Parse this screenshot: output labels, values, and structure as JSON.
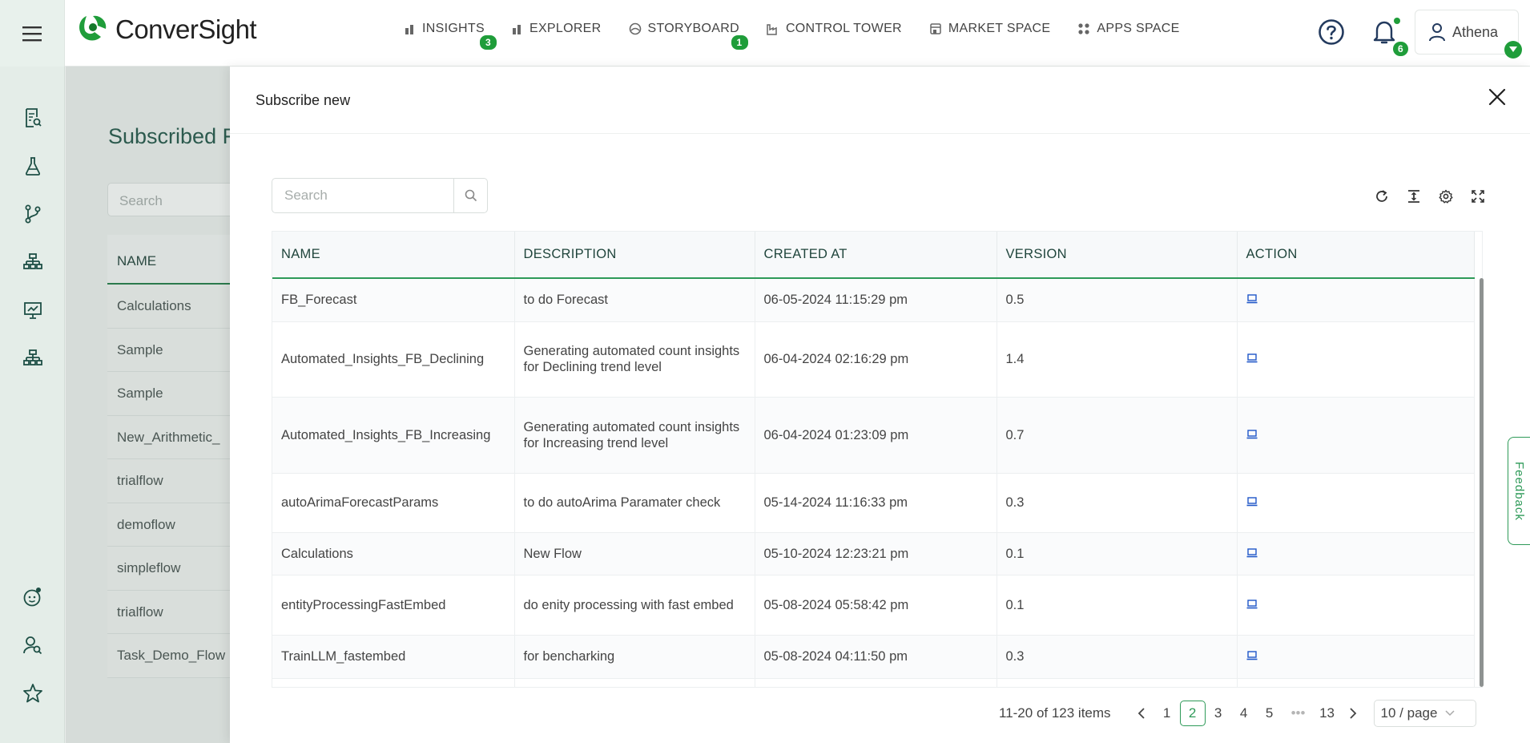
{
  "app": {
    "brand": "ConverSight",
    "colors": {
      "accent": "#1f9d3a",
      "header_text": "#20453c"
    }
  },
  "nav": {
    "items": [
      {
        "label": "INSIGHTS",
        "icon": "bar-chart-icon",
        "badge": "3"
      },
      {
        "label": "EXPLORER",
        "icon": "bar-chart-icon",
        "badge": ""
      },
      {
        "label": "STORYBOARD",
        "icon": "storyboard-icon",
        "badge": "1"
      },
      {
        "label": "CONTROL TOWER",
        "icon": "factory-icon",
        "badge": ""
      },
      {
        "label": "MARKET SPACE",
        "icon": "store-icon",
        "badge": ""
      },
      {
        "label": "APPS SPACE",
        "icon": "grid-icon",
        "badge": ""
      }
    ],
    "notifications_count": "6",
    "user_name": "Athena"
  },
  "background_page": {
    "title": "Subscribed F",
    "search_placeholder": "Search",
    "column": "NAME",
    "rows": [
      "Calculations",
      "Sample",
      "Sample",
      "New_Arithmetic_",
      "trialflow",
      "demoflow",
      "simpleflow",
      "trialflow",
      "Task_Demo_Flow"
    ]
  },
  "drawer": {
    "title": "Subscribe new",
    "search_placeholder": "Search",
    "columns": [
      "NAME",
      "DESCRIPTION",
      "CREATED AT",
      "VERSION",
      "ACTION"
    ],
    "rows": [
      {
        "name": "FB_Forecast",
        "description": "to do Forecast",
        "created_at": "06-05-2024 11:15:29 pm",
        "version": "0.5"
      },
      {
        "name": "Automated_Insights_FB_Declining",
        "description": "Generating automated count insights for Declining trend level",
        "created_at": "06-04-2024 02:16:29 pm",
        "version": "1.4"
      },
      {
        "name": "Automated_Insights_FB_Increasing",
        "description": "Generating automated count insights for Increasing trend level",
        "created_at": "06-04-2024 01:23:09 pm",
        "version": "0.7"
      },
      {
        "name": "autoArimaForecastParams",
        "description": "to do autoArima Paramater check",
        "created_at": "05-14-2024 11:16:33 pm",
        "version": "0.3"
      },
      {
        "name": "Calculations",
        "description": "New Flow",
        "created_at": "05-10-2024 12:23:21 pm",
        "version": "0.1"
      },
      {
        "name": "entityProcessingFastEmbed",
        "description": "do enity processing with fast embed",
        "created_at": "05-08-2024 05:58:42 pm",
        "version": "0.1"
      },
      {
        "name": "TrainLLM_fastembed",
        "description": "for bencharking",
        "created_at": "05-08-2024 04:11:50 pm",
        "version": "0.3"
      }
    ],
    "pagination": {
      "total_text": "11-20 of 123 items",
      "pages": [
        "1",
        "2",
        "3",
        "4",
        "5",
        "•••",
        "13"
      ],
      "current": "2",
      "page_size": "10 / page"
    }
  },
  "feedback_label": "Feedback"
}
